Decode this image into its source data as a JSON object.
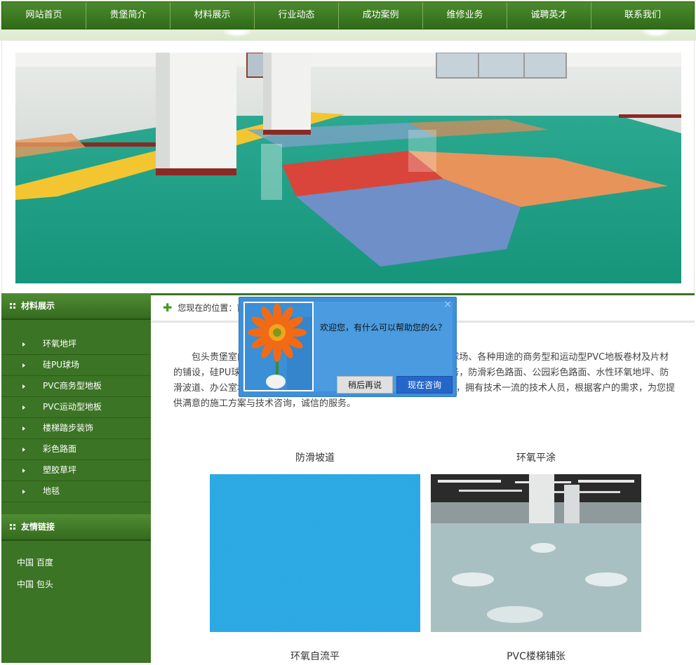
{
  "nav": {
    "items": [
      "网站首页",
      "贵堡简介",
      "材料展示",
      "行业动态",
      "成功案例",
      "维修业务",
      "诚聘英才",
      "联系我们"
    ]
  },
  "sidebar": {
    "materials_title": "材料展示",
    "materials": [
      "环氧地坪",
      "硅PU球场",
      "PVC商务型地板",
      "PVC运动型地板",
      "楼梯踏步装饰",
      "彩色路面",
      "塑胶草坪",
      "地毯"
    ],
    "links_title": "友情链接",
    "links": [
      "中国 百度",
      "中国 包头"
    ]
  },
  "breadcrumb": {
    "label": "您现在的位置：",
    "current": "首"
  },
  "intro": {
    "text": "包头贵堡室内外地坪工程有限公司专业从事各种环氧地坪、硅PU球场、各种用途的商务型和运动型PVC地板卷材及片材的铺设，硅PU球场、塑胶跑道、人造草坪等运动场地的施工及维修服务，防滑彩色路面、公园彩色路面、水性环氧地坪、防滑波道、办公室地毯等工程，公司以完善的服务体系为客户服务为主体，拥有技术一流的技术人员，根据客户的需求，为您提供满意的施工方案与技术咨询，诚信的服务。"
  },
  "gallery": [
    {
      "title": "防滑坡道"
    },
    {
      "title": "环氧平涂"
    },
    {
      "title": "环氧自流平"
    },
    {
      "title": "PVC楼梯铺张"
    }
  ],
  "popup": {
    "message": "欢迎您，有什么可以帮助您的么？",
    "later_label": "稍后再说",
    "now_label": "现在咨询",
    "close_icon": "×"
  },
  "colors": {
    "nav_green": "#2f6b17",
    "sidebar_green": "#3b7424",
    "popup_blue": "#3f8fd9",
    "consult_button": "#2567c9"
  }
}
